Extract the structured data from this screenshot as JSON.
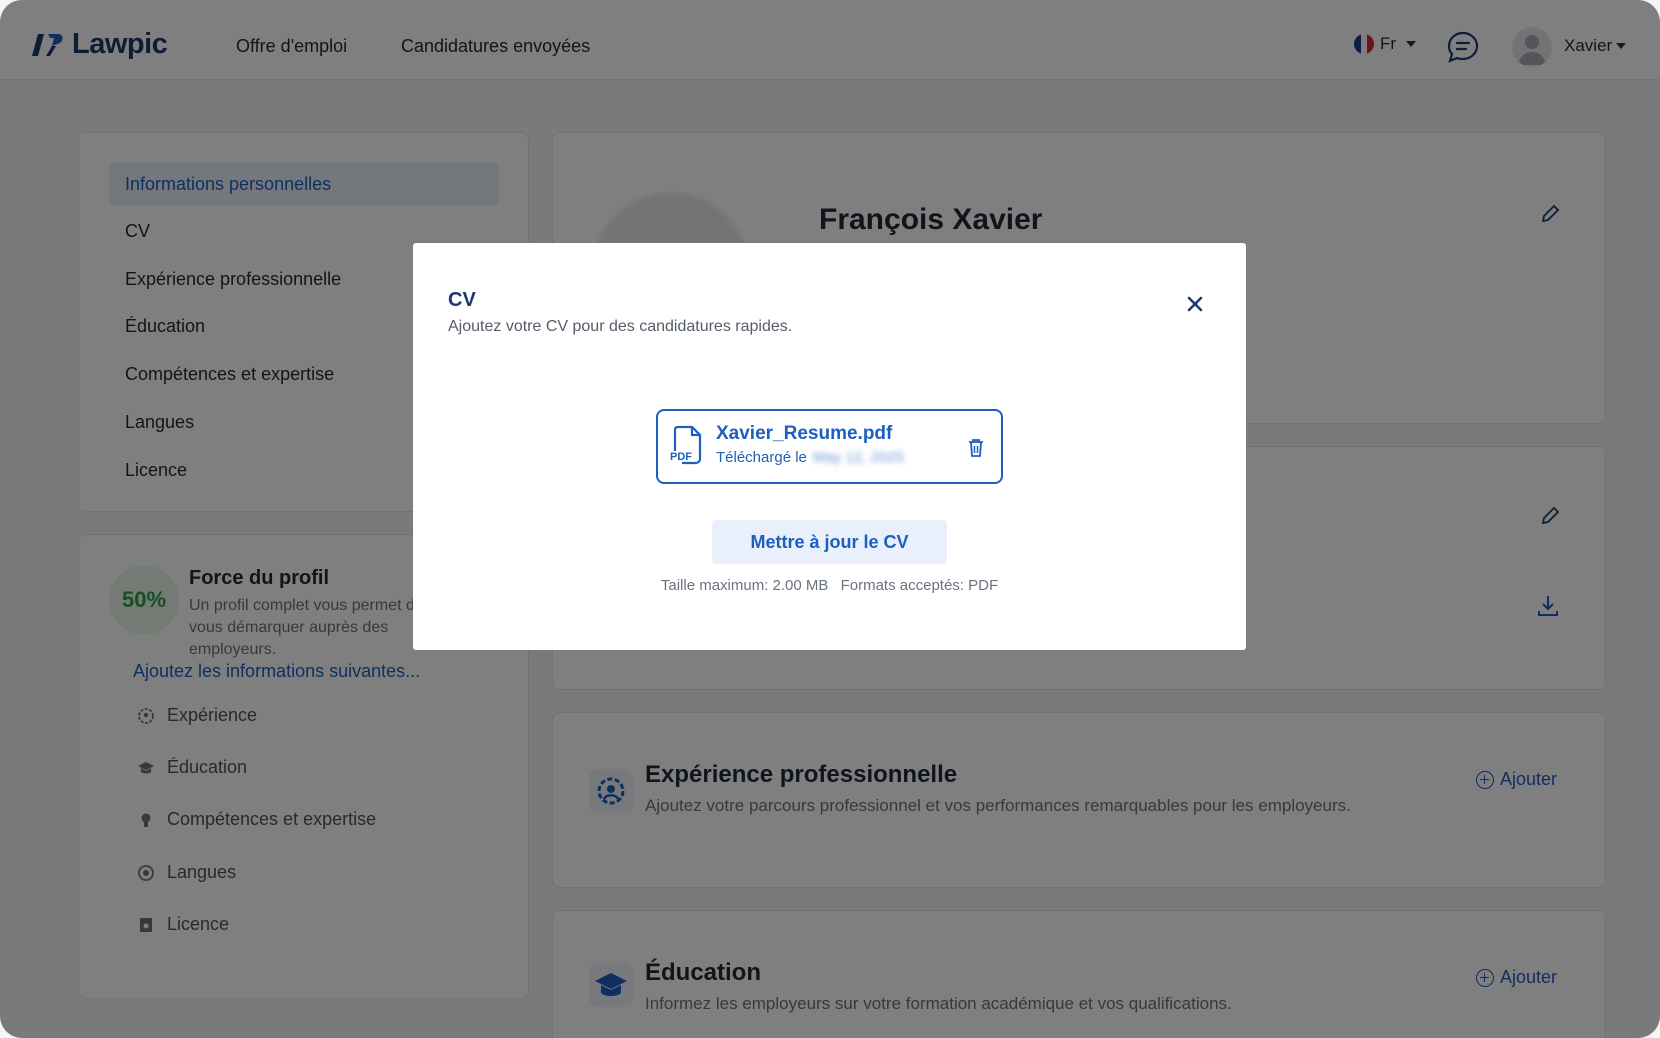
{
  "header": {
    "logo_text": "Lawpic",
    "nav": [
      "Offre d'emploi",
      "Candidatures envoyées"
    ],
    "language": "Fr",
    "user_name": "Xavier",
    "flag_colors": [
      "#1f3a93",
      "#ffffff",
      "#d7263d"
    ]
  },
  "sidebar": {
    "items": [
      {
        "label": "Informations personnelles",
        "active": true
      },
      {
        "label": "CV",
        "active": false
      },
      {
        "label": "Expérience professionnelle",
        "active": false
      },
      {
        "label": "Éducation",
        "active": false
      },
      {
        "label": "Compétences et expertise",
        "active": false
      },
      {
        "label": "Langues",
        "active": false
      },
      {
        "label": "Licence",
        "active": false
      }
    ]
  },
  "strength": {
    "percent": "50%",
    "title": "Force du profil",
    "description": "Un profil complet vous permet de vous démarquer auprès des employeurs.",
    "link": "Ajoutez les informations suivantes...",
    "todo": [
      {
        "label": "Expérience",
        "icon": "gear-user-icon"
      },
      {
        "label": "Éducation",
        "icon": "graduation-cap-icon"
      },
      {
        "label": "Compétences et expertise",
        "icon": "bulb-icon"
      },
      {
        "label": "Langues",
        "icon": "language-icon"
      },
      {
        "label": "Licence",
        "icon": "license-icon"
      }
    ]
  },
  "profile": {
    "name": "François Xavier"
  },
  "sections": {
    "experience": {
      "title": "Expérience professionnelle",
      "description": "Ajoutez votre parcours professionnel et vos performances remarquables pour les employeurs.",
      "add_label": "Ajouter"
    },
    "education": {
      "title": "Éducation",
      "description": "Informez les employeurs sur votre formation académique et vos qualifications.",
      "add_label": "Ajouter"
    }
  },
  "modal": {
    "title": "CV",
    "subtitle": "Ajoutez votre CV pour des candidatures rapides.",
    "file_name": "Xavier_Resume.pdf",
    "uploaded_label": "Téléchargé le",
    "uploaded_date": "May 12, 2025",
    "pdf_badge": "PDF",
    "update_button": "Mettre à jour le CV",
    "max_size": "Taille maximum: 2.00 MB",
    "formats": "Formats acceptés: PDF"
  },
  "colors": {
    "accent": "#1d5fbf",
    "brand": "#1b3a6b",
    "success": "#2e9e4b"
  }
}
